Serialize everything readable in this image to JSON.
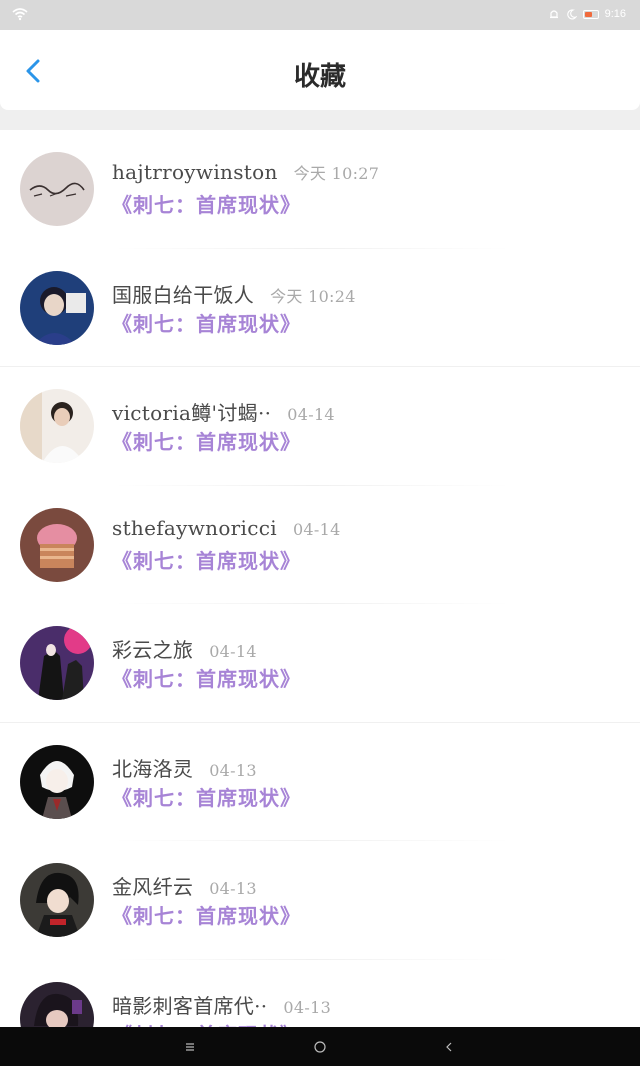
{
  "status_bar": {
    "time": "9:16",
    "icons": [
      "wifi-icon",
      "alarm-icon",
      "moon-icon",
      "battery-icon"
    ],
    "battery_color": "#f06a3c"
  },
  "header": {
    "title": "收藏",
    "back_icon": "chevron-left-icon",
    "accent_color": "#2b95e9"
  },
  "favorites": [
    {
      "name": "hajtrroywinston",
      "time": "今天 10:27",
      "article": "《刺七：首席现状》"
    },
    {
      "name": "国服白给干饭人",
      "time": "今天 10:24",
      "article": "《刺七：首席现状》"
    },
    {
      "name": "victoria鳟'讨蝎··",
      "time": "04-14",
      "article": "《刺七：首席现状》"
    },
    {
      "name": "sthefaywnoricci",
      "time": "04-14",
      "article": "《刺七：首席现状》"
    },
    {
      "name": "彩云之旅",
      "time": "04-14",
      "article": "《刺七：首席现状》"
    },
    {
      "name": "北海洛灵",
      "time": "04-13",
      "article": "《刺七：首席现状》"
    },
    {
      "name": "金风纤云",
      "time": "04-13",
      "article": "《刺七：首席现状》"
    },
    {
      "name": "暗影刺客首席代··",
      "time": "04-13",
      "article": "《刺七：首席现状》"
    }
  ],
  "colors": {
    "article_link": "#a784d6",
    "name_text": "#4a4a4a",
    "time_text": "#a9a9a9"
  },
  "nav_bar": {
    "icons": [
      "menu-icon",
      "home-circle-icon",
      "back-triangle-icon"
    ]
  }
}
